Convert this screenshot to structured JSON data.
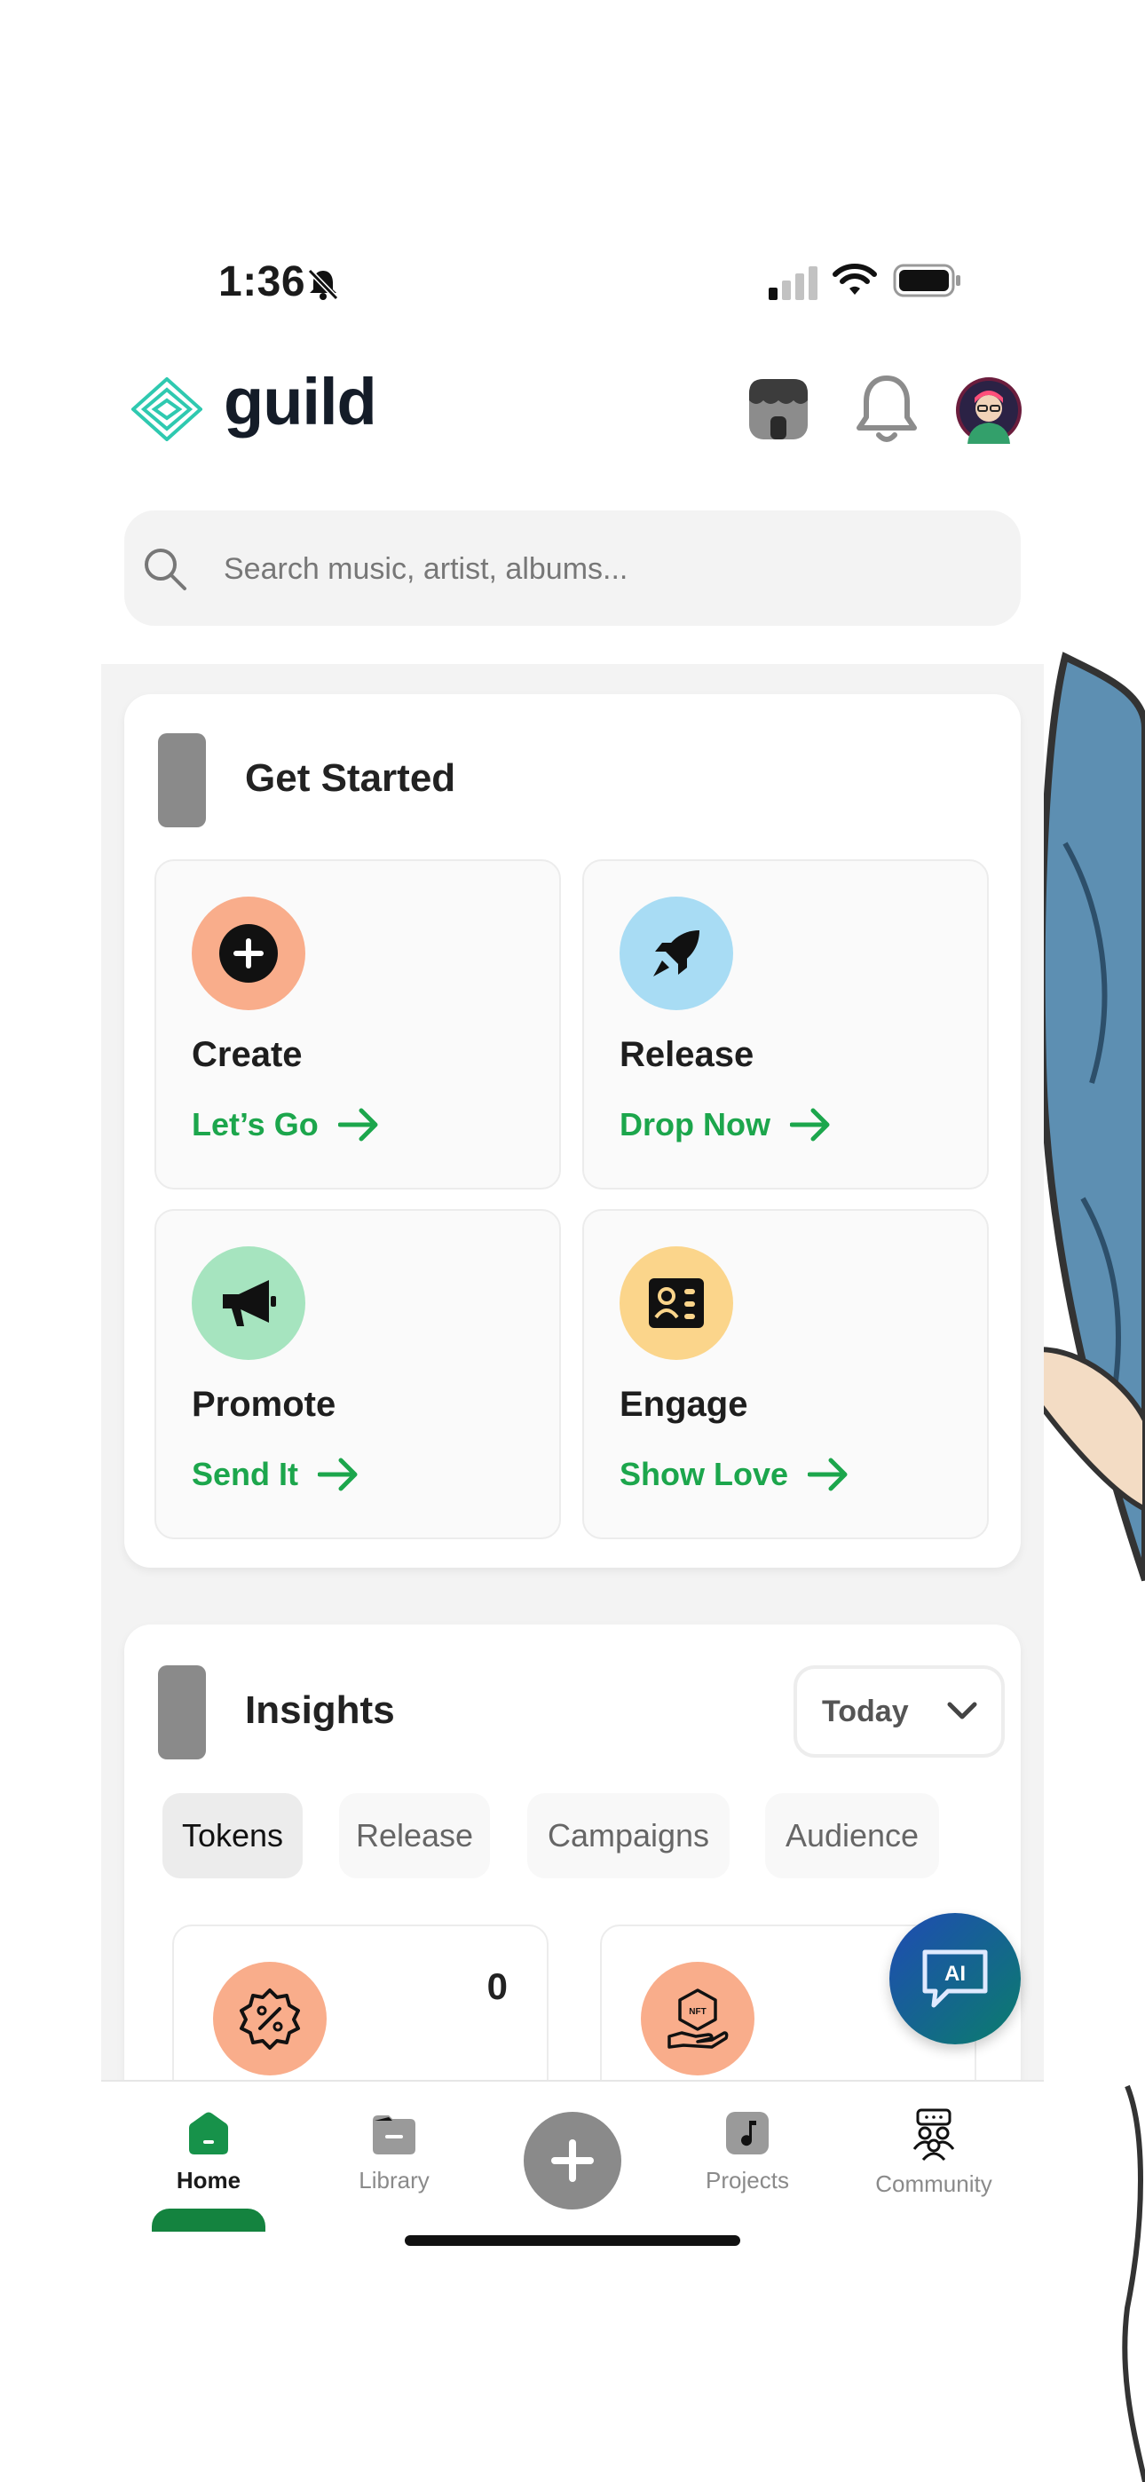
{
  "status_bar": {
    "time": "1:36"
  },
  "header": {
    "logo_text": "guild"
  },
  "search": {
    "placeholder": "Search music, artist, albums..."
  },
  "get_started": {
    "title": "Get Started",
    "tiles": [
      {
        "title": "Create",
        "link": "Let’s Go",
        "color": "#f9ad8b"
      },
      {
        "title": "Release",
        "link": "Drop Now",
        "color": "#a8dcf4"
      },
      {
        "title": "Promote",
        "link": "Send It",
        "color": "#a6e4bf"
      },
      {
        "title": "Engage",
        "link": "Show Love",
        "color": "#fbd58b"
      }
    ]
  },
  "insights": {
    "title": "Insights",
    "period": "Today",
    "tabs": [
      "Tokens",
      "Release",
      "Campaigns",
      "Audience"
    ],
    "active_tab": "Tokens",
    "stats": [
      {
        "value": "0",
        "icon": "discount-badge-icon"
      },
      {
        "value": "",
        "icon": "nft-hand-icon"
      }
    ]
  },
  "ai_button": {
    "label": "AI"
  },
  "tabbar": {
    "items": [
      {
        "label": "Home"
      },
      {
        "label": "Library"
      },
      {
        "label": "Projects"
      },
      {
        "label": "Community"
      }
    ]
  },
  "colors": {
    "accent": "#1ca64c",
    "logo": "#2fc9b0"
  }
}
